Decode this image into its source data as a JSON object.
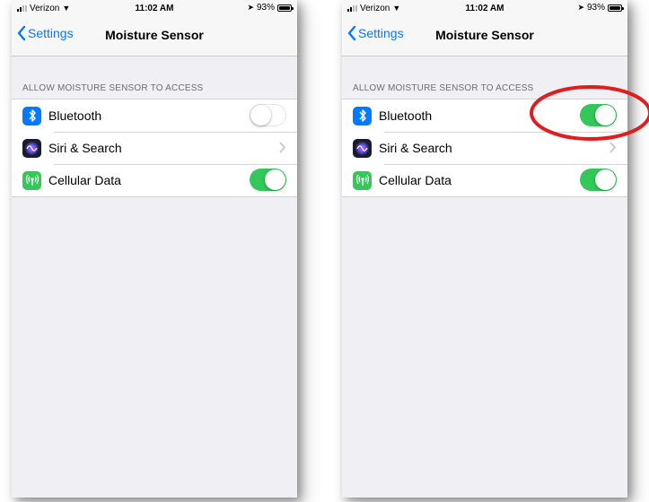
{
  "status": {
    "carrier": "Verizon",
    "time": "11:02 AM",
    "battery": "93%",
    "battery_level": 0.93
  },
  "nav": {
    "back_label": "Settings",
    "title": "Moisture Sensor"
  },
  "section": {
    "header": "ALLOW MOISTURE SENSOR TO ACCESS"
  },
  "rows": [
    {
      "label": "Bluetooth",
      "icon": "bluetooth-icon",
      "control": "toggle"
    },
    {
      "label": "Siri & Search",
      "icon": "siri-icon",
      "control": "chevron"
    },
    {
      "label": "Cellular Data",
      "icon": "cellular-icon",
      "control": "toggle"
    }
  ],
  "screens": [
    {
      "name": "before",
      "bluetooth_on": false,
      "cellular_on": true
    },
    {
      "name": "after",
      "bluetooth_on": true,
      "cellular_on": true
    }
  ],
  "colors": {
    "accent": "#007aff",
    "toggle_on": "#34c759",
    "callout": "#e01e1e"
  }
}
